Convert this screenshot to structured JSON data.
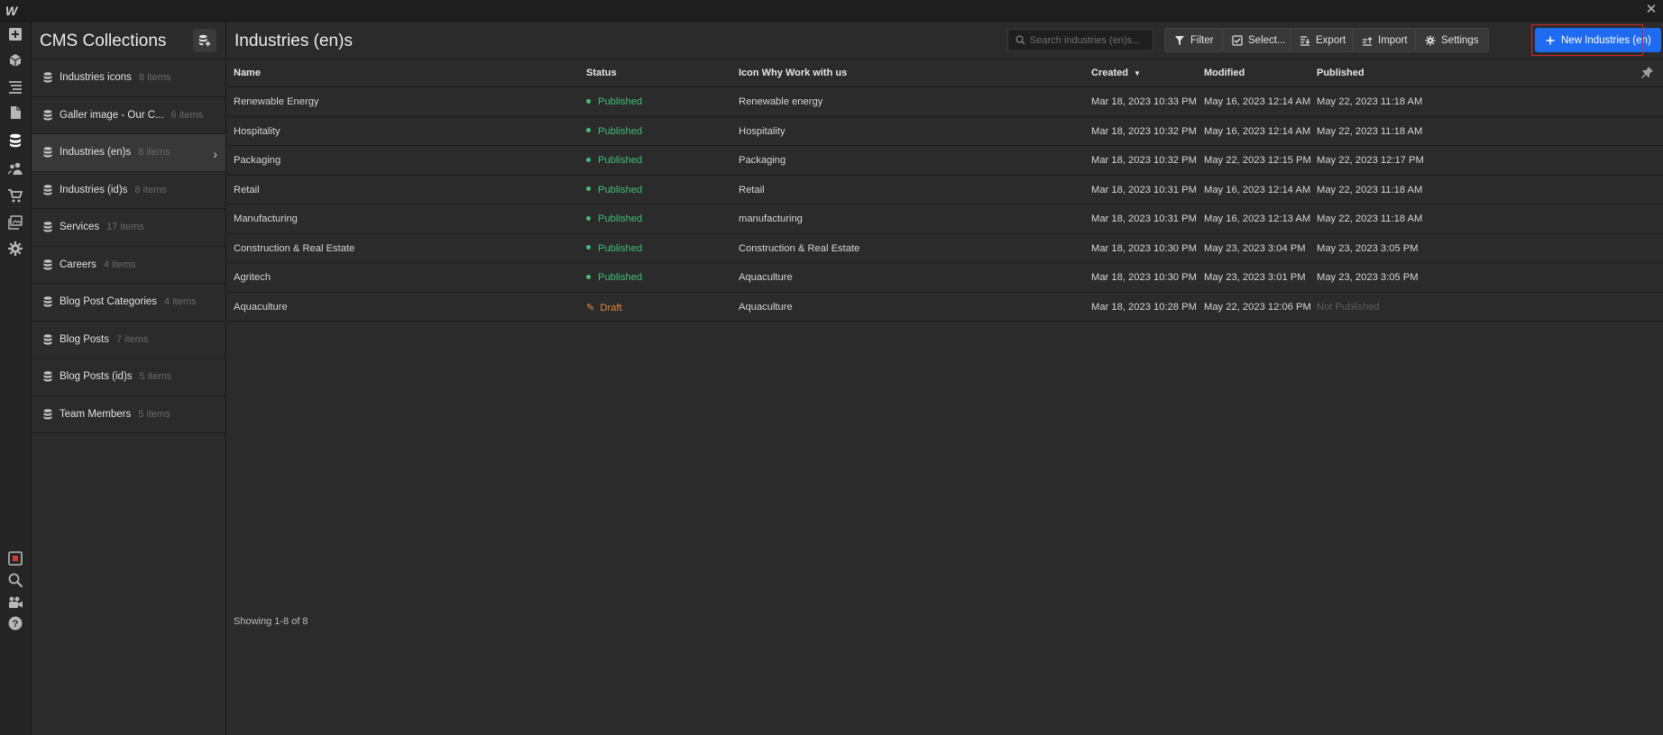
{
  "app": {
    "logo": "W",
    "close_icon": "close-icon"
  },
  "leftbar": {
    "items": [
      {
        "name": "add-panel",
        "icon": "plus-square-icon"
      },
      {
        "name": "components",
        "icon": "cube-icon"
      },
      {
        "name": "navigator",
        "icon": "navigator-icon"
      },
      {
        "name": "pages",
        "icon": "page-icon"
      },
      {
        "name": "cms",
        "icon": "database-icon",
        "active": true
      },
      {
        "name": "users",
        "icon": "users-icon"
      },
      {
        "name": "ecommerce",
        "icon": "cart-icon"
      },
      {
        "name": "assets",
        "icon": "image-icon"
      },
      {
        "name": "settings",
        "icon": "gear-icon"
      }
    ],
    "bottom": [
      {
        "name": "stop",
        "icon": "stop-icon"
      },
      {
        "name": "search",
        "icon": "search-icon"
      },
      {
        "name": "video",
        "icon": "video-icon"
      },
      {
        "name": "help",
        "icon": "help-icon"
      }
    ]
  },
  "cms": {
    "title": "CMS Collections",
    "collections": [
      {
        "name": "Industries icons",
        "count": "8 items"
      },
      {
        "name": "Galler image - Our C...",
        "count": "6 items"
      },
      {
        "name": "Industries (en)s",
        "count": "8 items",
        "active": true
      },
      {
        "name": "Industries (id)s",
        "count": "8 items"
      },
      {
        "name": "Services",
        "count": "17 items"
      },
      {
        "name": "Careers",
        "count": "4 items"
      },
      {
        "name": "Blog Post Categories",
        "count": "4 items"
      },
      {
        "name": "Blog Posts",
        "count": "7 items"
      },
      {
        "name": "Blog Posts (id)s",
        "count": "5 items"
      },
      {
        "name": "Team Members",
        "count": "5 items"
      }
    ]
  },
  "main": {
    "title": "Industries (en)s",
    "search_placeholder": "Search industries (en)s...",
    "buttons": {
      "filter": "Filter",
      "select": "Select...",
      "export": "Export",
      "import": "Import",
      "settings": "Settings",
      "new_item": "New Industries (en)"
    },
    "columns": {
      "name": "Name",
      "status": "Status",
      "icon": "Icon Why Work with us",
      "created": "Created",
      "modified": "Modified",
      "published": "Published"
    },
    "rows": [
      {
        "name": "Renewable Energy",
        "status": "Published",
        "icon": "Renewable energy",
        "created": "Mar 18, 2023 10:33 PM",
        "modified": "May 16, 2023 12:14 AM",
        "published": "May 22, 2023 11:18 AM"
      },
      {
        "name": "Hospitality",
        "status": "Published",
        "icon": "Hospitality",
        "created": "Mar 18, 2023 10:32 PM",
        "modified": "May 16, 2023 12:14 AM",
        "published": "May 22, 2023 11:18 AM"
      },
      {
        "name": "Packaging",
        "status": "Published",
        "icon": "Packaging",
        "created": "Mar 18, 2023 10:32 PM",
        "modified": "May 22, 2023 12:15 PM",
        "published": "May 22, 2023 12:17 PM"
      },
      {
        "name": "Retail",
        "status": "Published",
        "icon": "Retail",
        "created": "Mar 18, 2023 10:31 PM",
        "modified": "May 16, 2023 12:14 AM",
        "published": "May 22, 2023 11:18 AM"
      },
      {
        "name": "Manufacturing",
        "status": "Published",
        "icon": "manufacturing",
        "created": "Mar 18, 2023 10:31 PM",
        "modified": "May 16, 2023 12:13 AM",
        "published": "May 22, 2023 11:18 AM"
      },
      {
        "name": "Construction & Real Estate",
        "status": "Published",
        "icon": "Construction & Real Estate",
        "created": "Mar 18, 2023 10:30 PM",
        "modified": "May 23, 2023 3:04 PM",
        "published": "May 23, 2023 3:05 PM"
      },
      {
        "name": "Agritech",
        "status": "Published",
        "icon": "Aquaculture",
        "created": "Mar 18, 2023 10:30 PM",
        "modified": "May 23, 2023 3:01 PM",
        "published": "May 23, 2023 3:05 PM"
      },
      {
        "name": "Aquaculture",
        "status": "Draft",
        "icon": "Aquaculture",
        "created": "Mar 18, 2023 10:28 PM",
        "modified": "May 22, 2023 12:06 PM",
        "published": "Not Published"
      }
    ],
    "footer": "Showing 1-8 of 8"
  },
  "colors": {
    "accent": "#1e6bf0",
    "published": "#3fbf76",
    "draft": "#e88443",
    "highlight": "#d12a2a"
  }
}
